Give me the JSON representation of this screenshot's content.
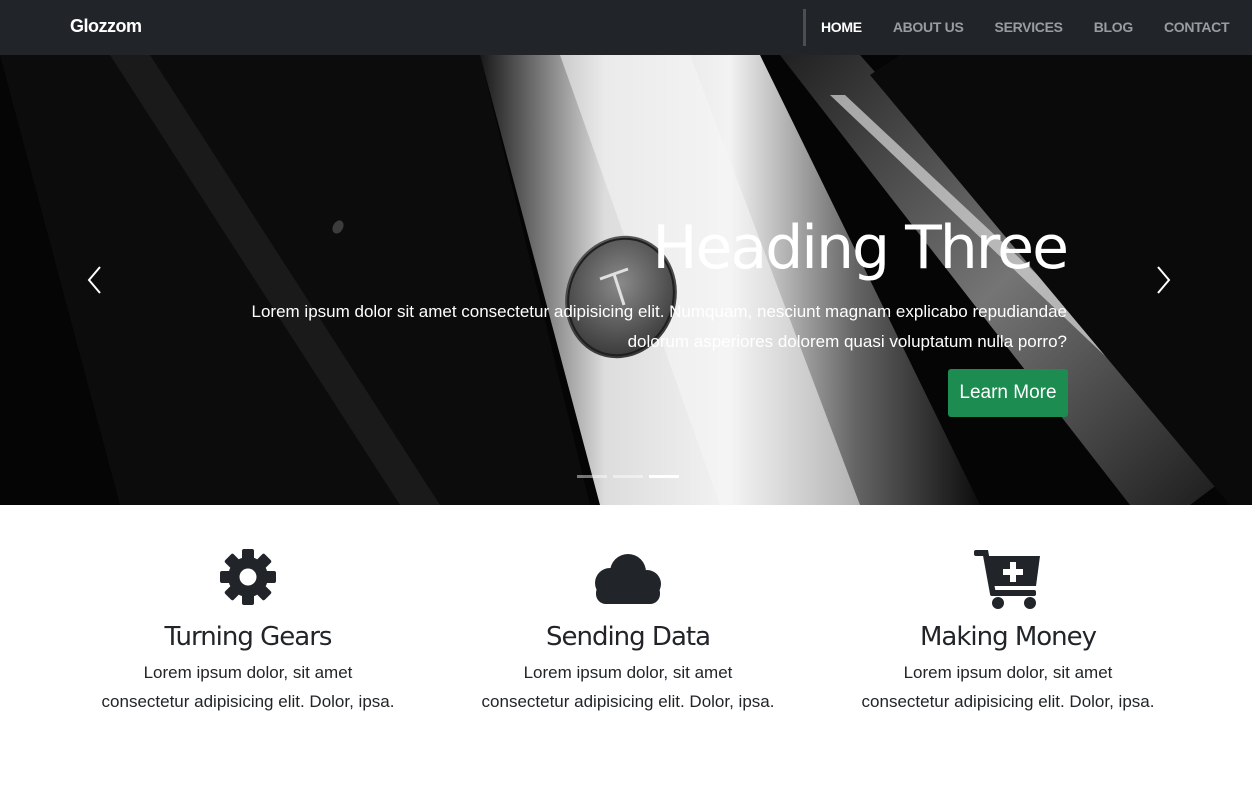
{
  "brand": "Glozzom",
  "nav": {
    "items": [
      {
        "label": "HOME",
        "active": true
      },
      {
        "label": "ABOUT US",
        "active": false
      },
      {
        "label": "SERVICES",
        "active": false
      },
      {
        "label": "BLOG",
        "active": false
      },
      {
        "label": "CONTACT",
        "active": false
      }
    ]
  },
  "hero": {
    "title": "Heading Three",
    "text": "Lorem ipsum dolor sit amet consectetur adipisicing elit. Numquam, nesciunt magnam explicabo repudiandae dolorum asperiores dolorem quasi voluptatum nulla porro?",
    "button_label": "Learn More",
    "slide_count": 3,
    "active_slide": 3,
    "prev_icon": "chevron-left-icon",
    "next_icon": "chevron-right-icon"
  },
  "features": [
    {
      "icon": "gear-icon",
      "title": "Turning Gears",
      "text": "Lorem ipsum dolor, sit amet consectetur adipisicing elit. Dolor, ipsa."
    },
    {
      "icon": "cloud-icon",
      "title": "Sending Data",
      "text": "Lorem ipsum dolor, sit amet consectetur adipisicing elit. Dolor, ipsa."
    },
    {
      "icon": "cart-plus-icon",
      "title": "Making Money",
      "text": "Lorem ipsum dolor, sit amet consectetur adipisicing elit. Dolor, ipsa."
    }
  ],
  "colors": {
    "navbar": "#212529",
    "button": "#1c8c50",
    "text": "#212529"
  }
}
